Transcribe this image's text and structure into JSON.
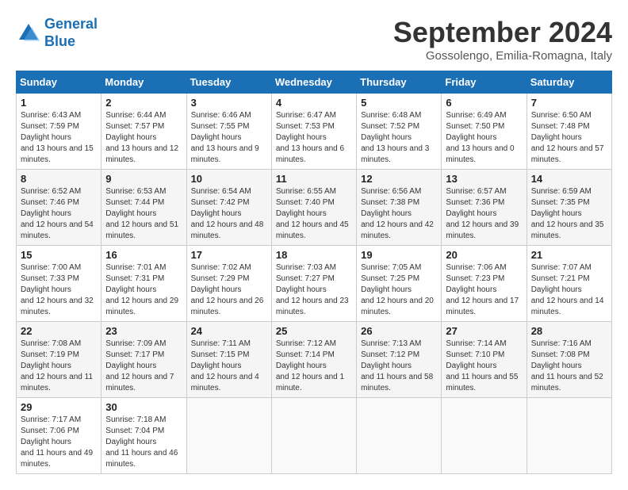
{
  "header": {
    "logo_line1": "General",
    "logo_line2": "Blue",
    "month_title": "September 2024",
    "location": "Gossolengo, Emilia-Romagna, Italy"
  },
  "weekdays": [
    "Sunday",
    "Monday",
    "Tuesday",
    "Wednesday",
    "Thursday",
    "Friday",
    "Saturday"
  ],
  "weeks": [
    [
      {
        "day": "1",
        "sunrise": "6:43 AM",
        "sunset": "7:59 PM",
        "daylight": "13 hours and 15 minutes."
      },
      {
        "day": "2",
        "sunrise": "6:44 AM",
        "sunset": "7:57 PM",
        "daylight": "13 hours and 12 minutes."
      },
      {
        "day": "3",
        "sunrise": "6:46 AM",
        "sunset": "7:55 PM",
        "daylight": "13 hours and 9 minutes."
      },
      {
        "day": "4",
        "sunrise": "6:47 AM",
        "sunset": "7:53 PM",
        "daylight": "13 hours and 6 minutes."
      },
      {
        "day": "5",
        "sunrise": "6:48 AM",
        "sunset": "7:52 PM",
        "daylight": "13 hours and 3 minutes."
      },
      {
        "day": "6",
        "sunrise": "6:49 AM",
        "sunset": "7:50 PM",
        "daylight": "13 hours and 0 minutes."
      },
      {
        "day": "7",
        "sunrise": "6:50 AM",
        "sunset": "7:48 PM",
        "daylight": "12 hours and 57 minutes."
      }
    ],
    [
      {
        "day": "8",
        "sunrise": "6:52 AM",
        "sunset": "7:46 PM",
        "daylight": "12 hours and 54 minutes."
      },
      {
        "day": "9",
        "sunrise": "6:53 AM",
        "sunset": "7:44 PM",
        "daylight": "12 hours and 51 minutes."
      },
      {
        "day": "10",
        "sunrise": "6:54 AM",
        "sunset": "7:42 PM",
        "daylight": "12 hours and 48 minutes."
      },
      {
        "day": "11",
        "sunrise": "6:55 AM",
        "sunset": "7:40 PM",
        "daylight": "12 hours and 45 minutes."
      },
      {
        "day": "12",
        "sunrise": "6:56 AM",
        "sunset": "7:38 PM",
        "daylight": "12 hours and 42 minutes."
      },
      {
        "day": "13",
        "sunrise": "6:57 AM",
        "sunset": "7:36 PM",
        "daylight": "12 hours and 39 minutes."
      },
      {
        "day": "14",
        "sunrise": "6:59 AM",
        "sunset": "7:35 PM",
        "daylight": "12 hours and 35 minutes."
      }
    ],
    [
      {
        "day": "15",
        "sunrise": "7:00 AM",
        "sunset": "7:33 PM",
        "daylight": "12 hours and 32 minutes."
      },
      {
        "day": "16",
        "sunrise": "7:01 AM",
        "sunset": "7:31 PM",
        "daylight": "12 hours and 29 minutes."
      },
      {
        "day": "17",
        "sunrise": "7:02 AM",
        "sunset": "7:29 PM",
        "daylight": "12 hours and 26 minutes."
      },
      {
        "day": "18",
        "sunrise": "7:03 AM",
        "sunset": "7:27 PM",
        "daylight": "12 hours and 23 minutes."
      },
      {
        "day": "19",
        "sunrise": "7:05 AM",
        "sunset": "7:25 PM",
        "daylight": "12 hours and 20 minutes."
      },
      {
        "day": "20",
        "sunrise": "7:06 AM",
        "sunset": "7:23 PM",
        "daylight": "12 hours and 17 minutes."
      },
      {
        "day": "21",
        "sunrise": "7:07 AM",
        "sunset": "7:21 PM",
        "daylight": "12 hours and 14 minutes."
      }
    ],
    [
      {
        "day": "22",
        "sunrise": "7:08 AM",
        "sunset": "7:19 PM",
        "daylight": "12 hours and 11 minutes."
      },
      {
        "day": "23",
        "sunrise": "7:09 AM",
        "sunset": "7:17 PM",
        "daylight": "12 hours and 7 minutes."
      },
      {
        "day": "24",
        "sunrise": "7:11 AM",
        "sunset": "7:15 PM",
        "daylight": "12 hours and 4 minutes."
      },
      {
        "day": "25",
        "sunrise": "7:12 AM",
        "sunset": "7:14 PM",
        "daylight": "12 hours and 1 minute."
      },
      {
        "day": "26",
        "sunrise": "7:13 AM",
        "sunset": "7:12 PM",
        "daylight": "11 hours and 58 minutes."
      },
      {
        "day": "27",
        "sunrise": "7:14 AM",
        "sunset": "7:10 PM",
        "daylight": "11 hours and 55 minutes."
      },
      {
        "day": "28",
        "sunrise": "7:16 AM",
        "sunset": "7:08 PM",
        "daylight": "11 hours and 52 minutes."
      }
    ],
    [
      {
        "day": "29",
        "sunrise": "7:17 AM",
        "sunset": "7:06 PM",
        "daylight": "11 hours and 49 minutes."
      },
      {
        "day": "30",
        "sunrise": "7:18 AM",
        "sunset": "7:04 PM",
        "daylight": "11 hours and 46 minutes."
      },
      null,
      null,
      null,
      null,
      null
    ]
  ]
}
